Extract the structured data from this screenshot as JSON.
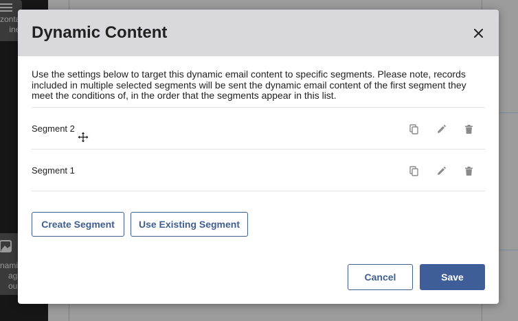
{
  "background": {
    "sidebar_items": [
      {
        "label": "zonta\nine",
        "icon": "horizontal-line-icon"
      },
      {
        "label": "namic\nage\noup",
        "icon": "dynamic-image-icon"
      }
    ]
  },
  "modal": {
    "title": "Dynamic Content",
    "close_icon": "close-icon",
    "description": "Use the settings below to target this dynamic email content to specific segments. Please note, records included in multiple selected segments will be sent the dynamic email content of the first segment they meet the conditions of, in the order that the segments appear in this list.",
    "segments": [
      {
        "name": "Segment 2",
        "actions": [
          "copy-icon",
          "edit-icon",
          "delete-icon"
        ]
      },
      {
        "name": "Segment 1",
        "actions": [
          "copy-icon",
          "edit-icon",
          "delete-icon"
        ]
      }
    ],
    "buttons": {
      "create_segment": "Create Segment",
      "use_existing_segment": "Use Existing Segment",
      "cancel": "Cancel",
      "save": "Save"
    }
  },
  "colors": {
    "header_bg": "#d9d9dd",
    "primary": "#3f5d98",
    "overlay_bg": "#9c9c9c",
    "sidebar_bg": "#161616"
  }
}
